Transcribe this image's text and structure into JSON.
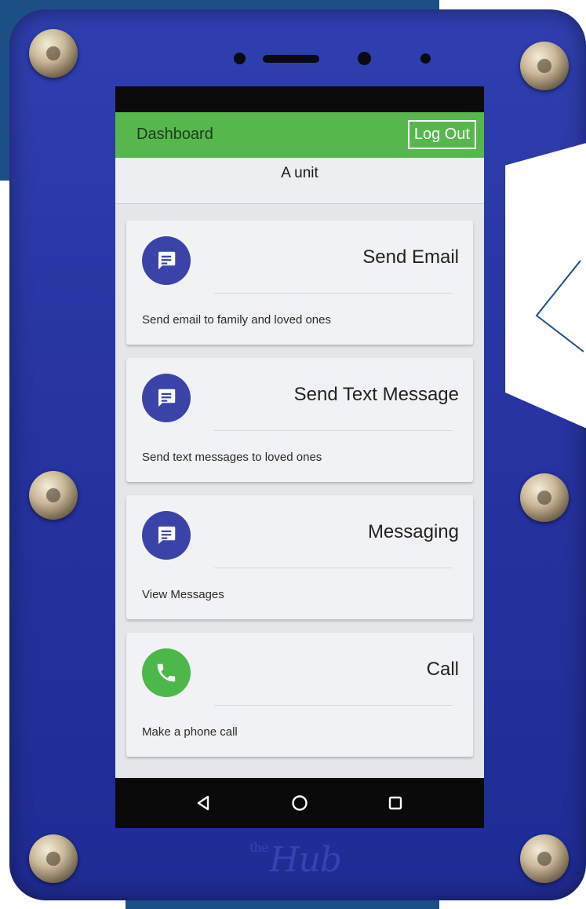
{
  "app_bar": {
    "title": "Dashboard",
    "logout_label": "Log Out"
  },
  "unit_label": "A unit",
  "cards": [
    {
      "title": "Send Email",
      "description": "Send email to family and loved ones",
      "icon": "message-icon",
      "icon_color": "#3a44a8"
    },
    {
      "title": "Send Text Message",
      "description": "Send text messages to loved ones",
      "icon": "message-icon",
      "icon_color": "#3a44a8"
    },
    {
      "title": "Messaging",
      "description": "View Messages",
      "icon": "message-icon",
      "icon_color": "#3a44a8"
    },
    {
      "title": "Call",
      "description": "Make a phone call",
      "icon": "phone-icon",
      "icon_color": "#4cb84a"
    }
  ],
  "nav": {
    "back_icon": "back-triangle-icon",
    "home_icon": "home-circle-icon",
    "recents_icon": "recents-square-icon"
  },
  "brand": {
    "small": "the",
    "name": "Hub"
  },
  "colors": {
    "appbar": "#56b84c",
    "case": "#2a37a6",
    "background_panel": "#1c4f86"
  }
}
